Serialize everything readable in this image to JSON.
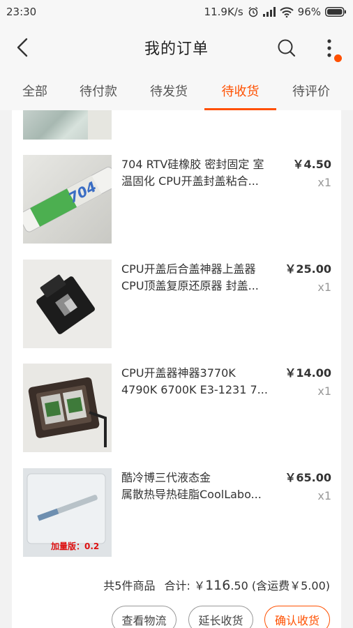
{
  "status_bar": {
    "time": "23:30",
    "network_speed": "11.9K/s",
    "battery": "96%",
    "icons": [
      "alarm-icon",
      "signal-icon",
      "wifi-icon",
      "battery-icon"
    ]
  },
  "header": {
    "title": "我的订单",
    "icons": [
      "back-icon",
      "search-icon",
      "more-icon"
    ],
    "accent": "#ff5000"
  },
  "tabs": [
    {
      "label": "全部",
      "active": false
    },
    {
      "label": "待付款",
      "active": false
    },
    {
      "label": "待发货",
      "active": false
    },
    {
      "label": "待收货",
      "active": true
    },
    {
      "label": "待评价",
      "active": false
    }
  ],
  "items": [
    {
      "line1": "704 RTV硅橡胶 密封固定 室",
      "line2": "温固化 CPU开盖封盖粘合...",
      "price": "￥4.50",
      "qty": "x1",
      "thumb_text": "704"
    },
    {
      "line1": "CPU开盖后合盖神器上盖器",
      "line2": "CPU顶盖复原还原器 封盖...",
      "price": "￥25.00",
      "qty": "x1"
    },
    {
      "line1": "CPU开盖器神器3770K",
      "line2": "4790K 6700K E3-1231 7...",
      "price": "￥14.00",
      "qty": "x1"
    },
    {
      "line1": "酷冷博三代液态金",
      "line2": "属散热导热硅脂CoolLabo...",
      "price": "￥65.00",
      "qty": "x1",
      "thumb_text": "加量版：0.2"
    }
  ],
  "summary": {
    "count_text": "共5件商品",
    "total_label": "合计:",
    "currency": "￥",
    "total_int": "116",
    "total_dec": ".50",
    "shipping": "(含运费￥5.00)"
  },
  "buttons": {
    "logistics": "查看物流",
    "extend": "延长收货",
    "confirm": "确认收货"
  }
}
